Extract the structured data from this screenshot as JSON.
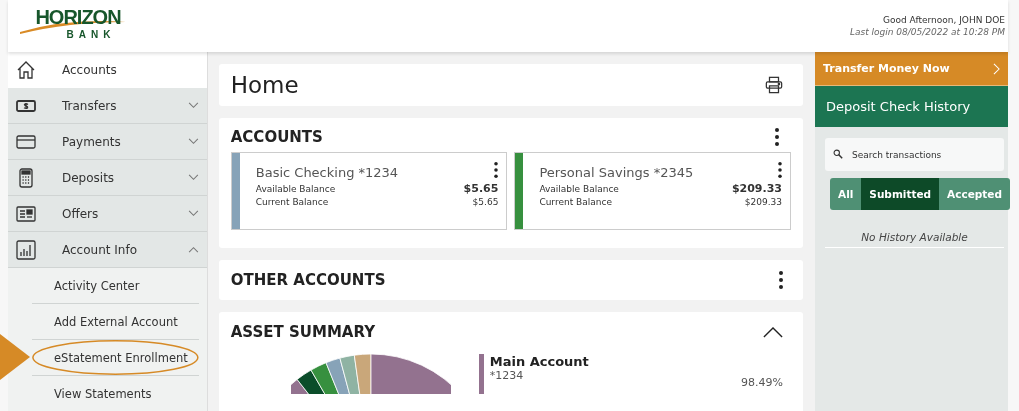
{
  "header": {
    "logo_top": "HORIZON",
    "logo_bottom": "BANK",
    "greeting": "Good Afternoon, JOHN DOE",
    "last_login": "Last login 08/05/2022 at 10:28 PM"
  },
  "sidebar": {
    "items": [
      {
        "label": "Accounts",
        "selected": true
      },
      {
        "label": "Transfers",
        "selected": false,
        "expanded": false
      },
      {
        "label": "Payments",
        "selected": false,
        "expanded": false
      },
      {
        "label": "Deposits",
        "selected": false,
        "expanded": false
      },
      {
        "label": "Offers",
        "selected": false,
        "expanded": false
      },
      {
        "label": "Account Info",
        "selected": false,
        "expanded": true,
        "children": [
          {
            "label": "Activity Center",
            "highlighted": false
          },
          {
            "label": "Add External Account",
            "highlighted": false
          },
          {
            "label": "eStatement Enrollment",
            "highlighted": true
          },
          {
            "label": "View Statements",
            "highlighted": false
          }
        ]
      }
    ]
  },
  "page_title": "Home",
  "accounts": {
    "title": "ACCOUNTS",
    "cards": [
      {
        "name": "Basic Checking *1234",
        "color": "#87a3b8",
        "available_label": "Available Balance",
        "available": "$5.65",
        "current_label": "Current Balance",
        "current": "$5.65"
      },
      {
        "name": "Personal Savings *2345",
        "color": "#37903f",
        "available_label": "Available Balance",
        "available": "$209.33",
        "current_label": "Current Balance",
        "current": "$209.33"
      }
    ]
  },
  "other_accounts": {
    "title": "OTHER ACCOUNTS"
  },
  "asset_summary": {
    "title": "ASSET SUMMARY",
    "legend": [
      {
        "name": "Main Account",
        "number": "*1234",
        "percent": "98.49%",
        "color": "#93728f"
      }
    ]
  },
  "right_panel": {
    "transfer_button": "Transfer Money Now",
    "history_title": "Deposit Check History",
    "search": {
      "placeholder": "Search transactions"
    },
    "tabs": [
      {
        "label": "All",
        "selected": false
      },
      {
        "label": "Submitted",
        "selected": true
      },
      {
        "label": "Accepted",
        "selected": false
      }
    ],
    "empty_message": "No History Available"
  }
}
